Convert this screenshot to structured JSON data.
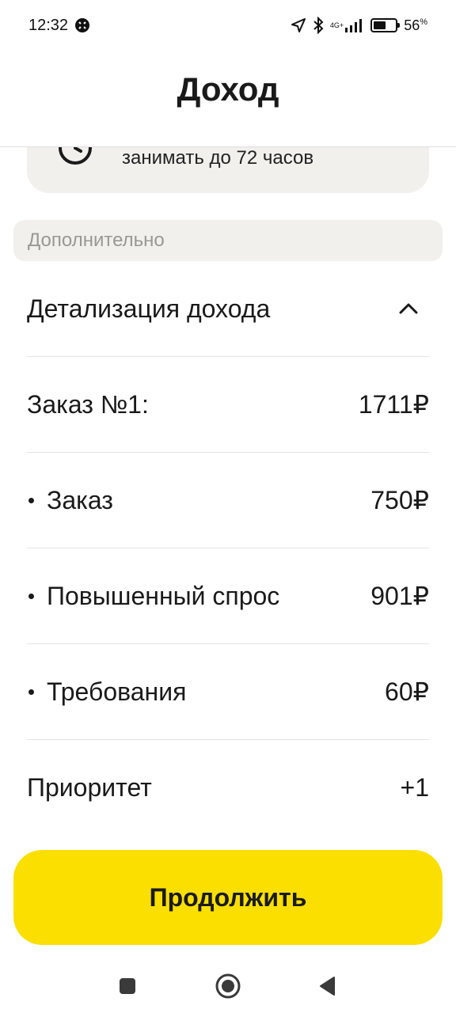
{
  "status_bar": {
    "time": "12:32",
    "network": "4G+",
    "battery_percent": "56",
    "battery_unit": "%",
    "battery_level": 0.56,
    "icons": [
      "notification-app-icon",
      "location-arrow-icon",
      "bluetooth-icon",
      "signal-icon",
      "battery-icon"
    ]
  },
  "header": {
    "title": "Доход"
  },
  "info_card": {
    "text": "занимать до 72 часов",
    "icon": "clock-icon"
  },
  "section": {
    "label": "Дополнительно"
  },
  "details": {
    "title": "Детализация дохода",
    "toggle_icon": "chevron-up-icon",
    "order_label": "Заказ №1:",
    "order_total": "1711₽",
    "items": [
      {
        "label": "Заказ",
        "value": "750₽"
      },
      {
        "label": "Повышенный спрос",
        "value": "901₽"
      },
      {
        "label": "Требования",
        "value": "60₽"
      }
    ],
    "priority_label": "Приоритет",
    "priority_value": "+1"
  },
  "actions": {
    "continue_label": "Продолжить"
  },
  "navigation": {
    "icons": [
      "recents-square-icon",
      "home-circle-icon",
      "back-triangle-icon"
    ]
  },
  "colors": {
    "accent": "#fadf00",
    "card_bg": "#f1f0ed",
    "muted_text": "#9a9893"
  }
}
